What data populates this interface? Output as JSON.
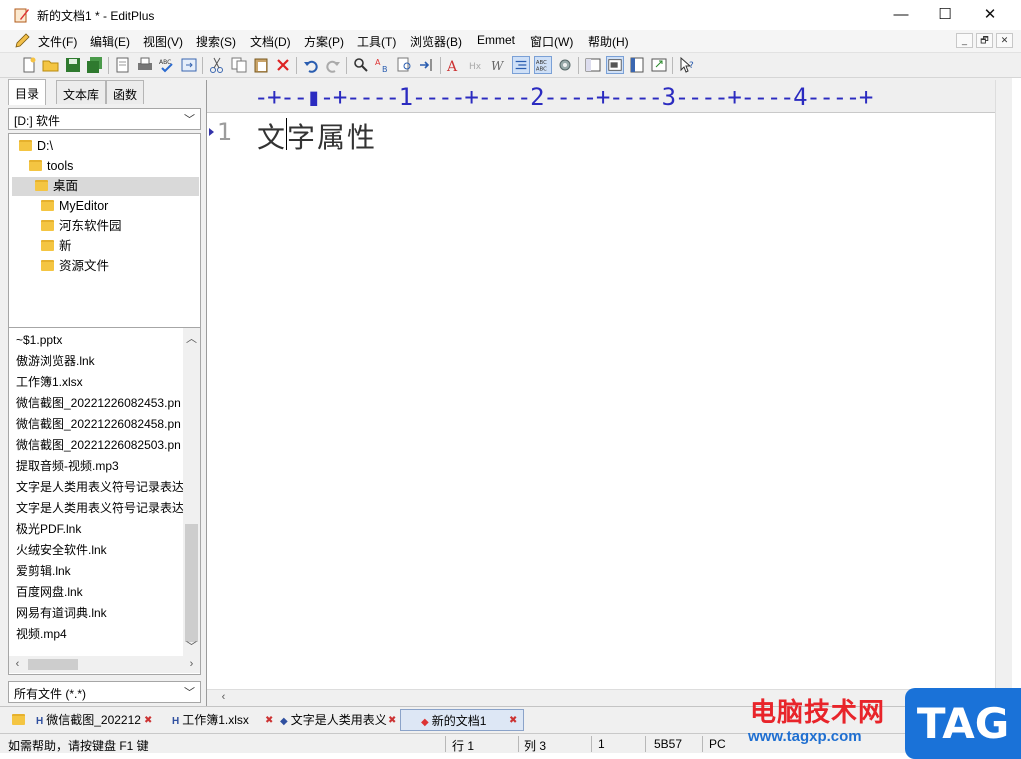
{
  "window": {
    "title": "新的文档1 * - EditPlus",
    "controls": {
      "minimize": "—",
      "maximize": "☐",
      "close": "✕"
    }
  },
  "menu": [
    "文件(F)",
    "编辑(E)",
    "视图(V)",
    "搜索(S)",
    "文档(D)",
    "方案(P)",
    "工具(T)",
    "浏览器(B)",
    "Emmet",
    "窗口(W)",
    "帮助(H)"
  ],
  "mdi_controls": [
    "_",
    "🗗",
    "✕"
  ],
  "left_panel": {
    "tabs": [
      "目录",
      "文本库",
      "函数"
    ],
    "drive": "[D:] 软件",
    "tree": [
      "D:\\",
      "tools",
      "桌面",
      "MyEditor",
      "河东软件园",
      "新",
      "资源文件"
    ],
    "files": [
      "~$1.pptx",
      "傲游浏览器.lnk",
      "工作簿1.xlsx",
      "微信截图_20221226082453.pn",
      "微信截图_20221226082458.pn",
      "微信截图_20221226082503.pn",
      "提取音频-视频.mp3",
      "文字是人类用表义符号记录表达",
      "文字是人类用表义符号记录表达",
      "极光PDF.lnk",
      "火绒安全软件.lnk",
      "爱剪辑.lnk",
      "百度网盘.lnk",
      "网易有道词典.lnk",
      "视频.mp4"
    ],
    "filter": "所有文件 (*.*)"
  },
  "editor": {
    "ruler": "-+--▮-+----1----+----2----+----3----+----4----+",
    "line_number": "1",
    "content": "文字属性"
  },
  "doc_tabs": [
    "微信截图_202212",
    "工作簿1.xlsx",
    "文字是人类用表义",
    "新的文档1"
  ],
  "status": {
    "help": "如需帮助，请按键盘 F1 键",
    "line": "行 1",
    "col": "列 3",
    "sel": "1",
    "code": "5B57",
    "mode": "PC"
  },
  "watermark": {
    "site": "电脑技术网",
    "url": "www.tagxp.com",
    "tag": "TAG"
  },
  "colors": {
    "accent": "#0a0a7a",
    "ruler_text": "#2b2bc0",
    "watermark_red": "#e8242a",
    "watermark_blue": "#1a72d8"
  }
}
